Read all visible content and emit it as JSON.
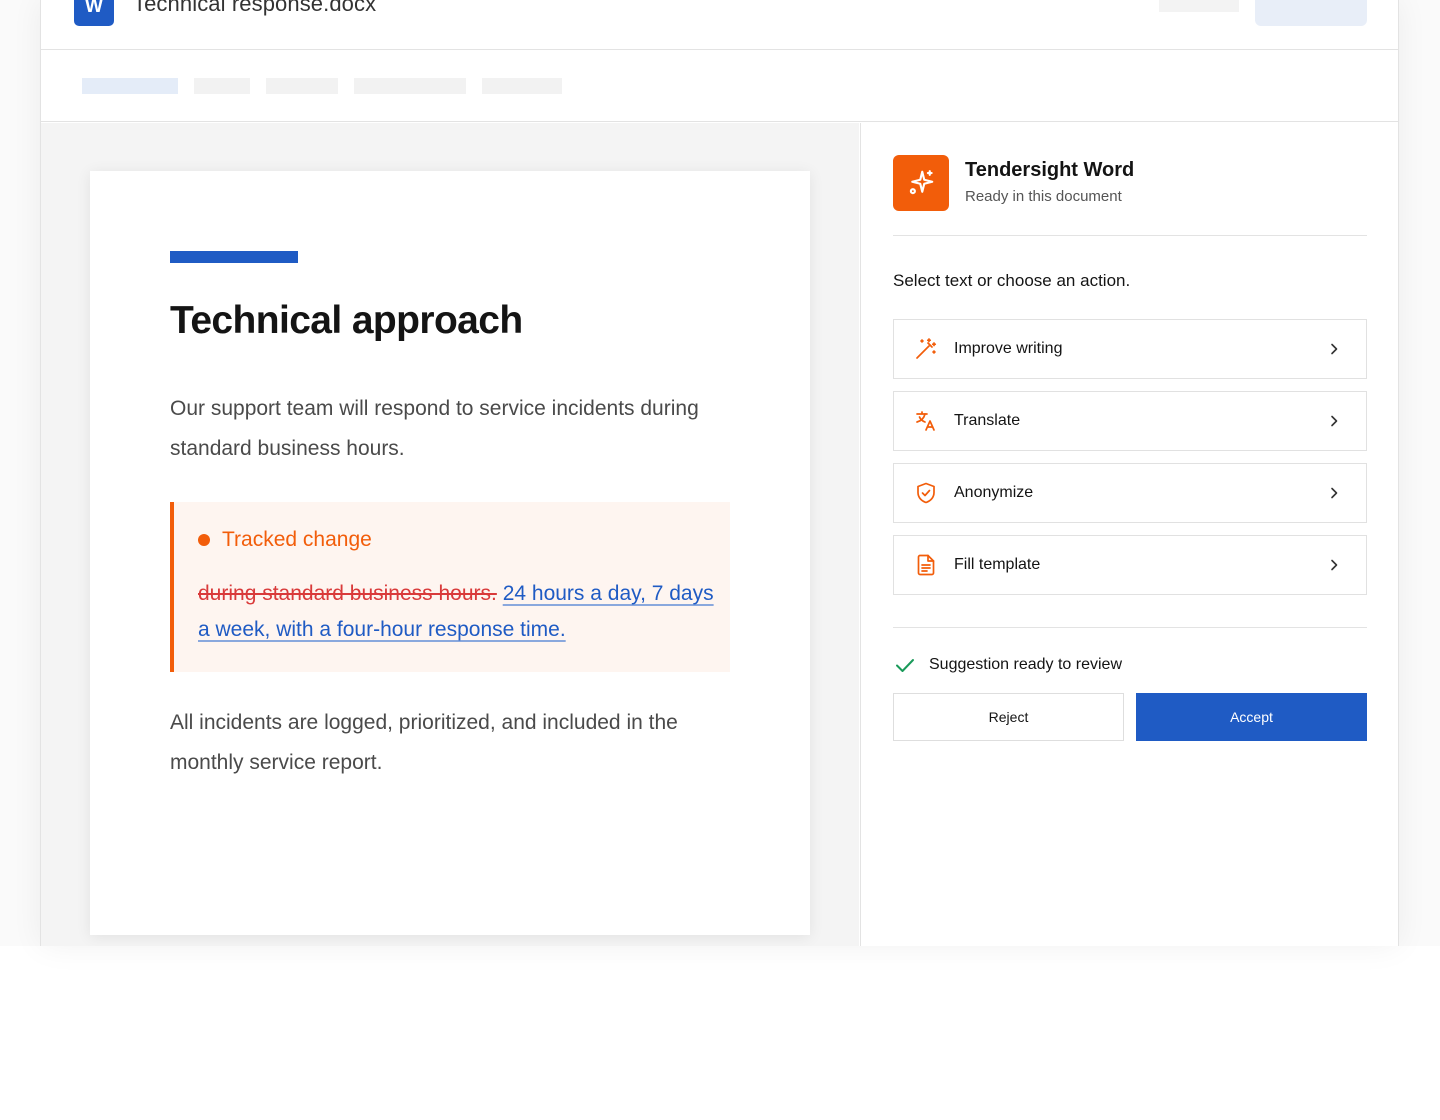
{
  "window": {
    "doc_title": "Technical response.docx",
    "app_icon_letter": "W"
  },
  "document": {
    "heading": "Technical approach",
    "paragraph_1": "Our support team will respond to service incidents during standard business hours.",
    "tracked_change": {
      "label": "Tracked change",
      "deleted": "during standard business hours.",
      "inserted": "24 hours a day, 7 days a week, with a four-hour response time."
    },
    "paragraph_2": "All incidents are logged, prioritized, and included in the monthly service report."
  },
  "panel": {
    "title": "Tendersight Word",
    "subtitle": "Ready in this document",
    "prompt": "Select text or choose an action.",
    "actions": [
      {
        "label": "Improve writing",
        "icon": "magic-wand-icon"
      },
      {
        "label": "Translate",
        "icon": "translate-icon"
      },
      {
        "label": "Anonymize",
        "icon": "shield-check-icon"
      },
      {
        "label": "Fill template",
        "icon": "document-icon"
      }
    ],
    "status": "Suggestion ready to review",
    "reject_label": "Reject",
    "accept_label": "Accept"
  },
  "colors": {
    "brand_orange": "#f25d0a",
    "word_blue": "#1f5bc4",
    "deletion_red": "#d93a3a",
    "success_green": "#1a9a5a"
  }
}
